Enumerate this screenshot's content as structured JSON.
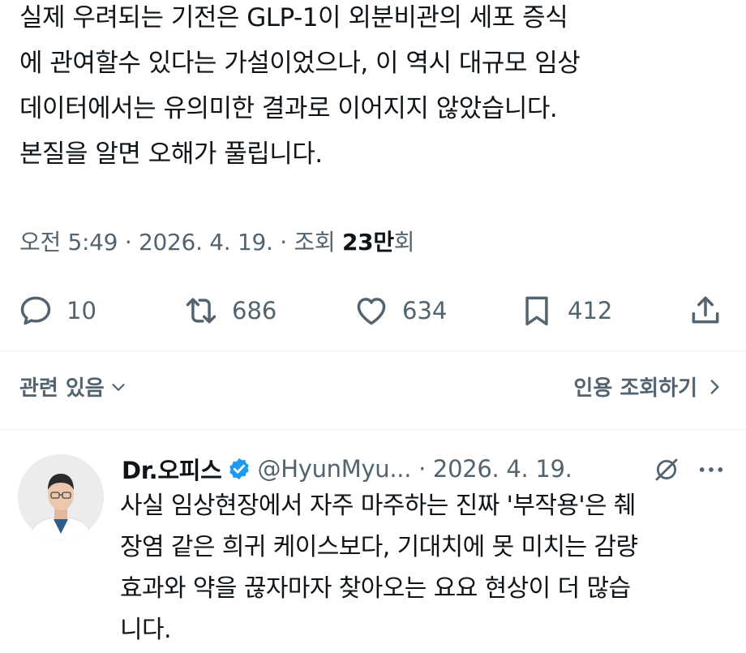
{
  "tweet": {
    "lines": [
      "실제 우려되는 기전은 GLP-1이 외분비관의 세포 증식",
      "에 관여할수 있다는 가설이었으나, 이 역시 대규모 임상",
      "데이터에서는 유의미한 결과로 이어지지 않았습니다.",
      "본질을 알면 오해가 풀립니다."
    ],
    "time": "오전 5:49",
    "date": "2026. 4. 19.",
    "views_label": "조회",
    "views_count": "23만",
    "views_suffix": "회"
  },
  "actions": {
    "reply_count": "10",
    "retweet_count": "686",
    "like_count": "634",
    "bookmark_count": "412"
  },
  "related": {
    "label": "관련 있음",
    "quote_views_label": "인용 조회하기"
  },
  "reply": {
    "name": "Dr.오피스",
    "handle": "@HyunMyu...",
    "date": "2026. 4. 19.",
    "lines": [
      "사실 임상현장에서 자주 마주하는 진짜 '부작용'은 췌",
      "장염 같은 희귀 케이스보다, 기대치에 못 미치는 감량",
      "효과와 약을 끊자마자 찾아오는 요요 현상이 더 많습",
      "니다."
    ]
  },
  "colors": {
    "text": "#0f1419",
    "secondary": "#536471",
    "verified": "#1d9bf0",
    "divider": "#eff3f4"
  },
  "icons": [
    "reply-icon",
    "retweet-icon",
    "like-icon",
    "bookmark-icon",
    "share-icon",
    "chevron-down-icon",
    "chevron-right-icon",
    "verified-badge-icon",
    "grok-icon",
    "more-icon"
  ]
}
